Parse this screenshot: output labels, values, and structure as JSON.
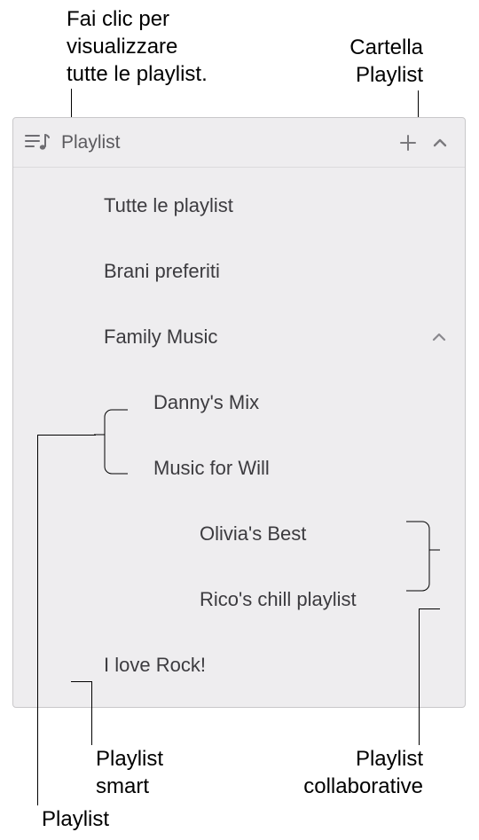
{
  "callouts": {
    "top_left": "Fai clic per\nvisualizzare\ntutte le playlist.",
    "top_right": "Cartella\nPlaylist",
    "bottom_smart": "Playlist\nsmart",
    "bottom_collab": "Playlist\ncollaborative",
    "bottom_playlist": "Playlist"
  },
  "sidebar": {
    "header": {
      "title": "Playlist"
    },
    "items": [
      {
        "label": "Tutte le playlist",
        "icon": "grid"
      },
      {
        "label": "Brani preferiti",
        "icon": "star-square"
      },
      {
        "label": "Family Music",
        "icon": "folder",
        "folder": true
      },
      {
        "label": "Danny's Mix",
        "icon": "playlist-note",
        "nested": 1
      },
      {
        "label": "Music for Will",
        "icon": "playlist-note",
        "nested": 1
      },
      {
        "label": "Olivia's Best",
        "icon": "people",
        "nested": 2
      },
      {
        "label": "Rico's chill playlist",
        "icon": "people",
        "nested": 2
      },
      {
        "label": "I love Rock!",
        "icon": "gear"
      }
    ]
  }
}
